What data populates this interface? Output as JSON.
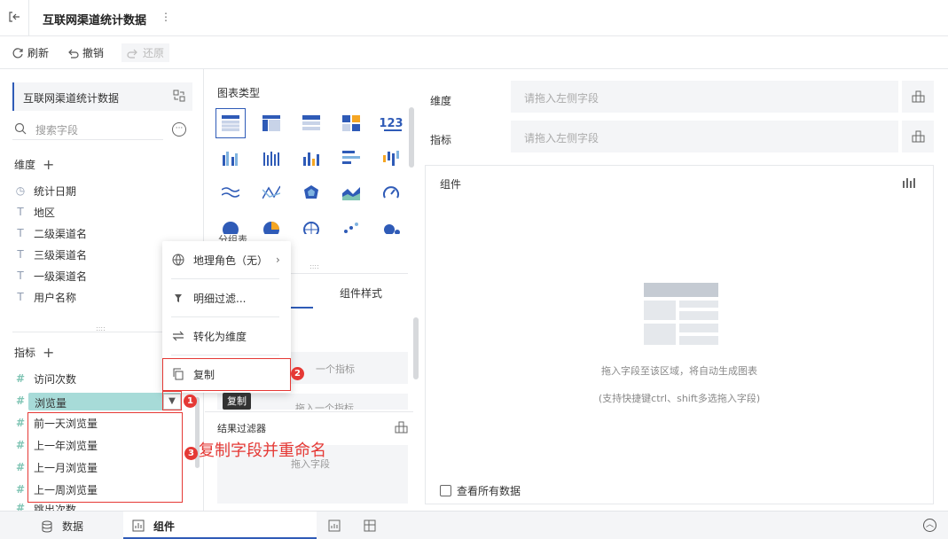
{
  "topbar": {
    "title": "互联网渠道统计数据",
    "more": "⋮"
  },
  "toolbar": {
    "refresh": "刷新",
    "undo": "撤销",
    "redo": "还原"
  },
  "left": {
    "dataset": "互联网渠道统计数据",
    "search_placeholder": "搜索字段",
    "dimension_header": "维度",
    "dimensions": [
      "统计日期",
      "地区",
      "二级渠道名",
      "三级渠道名",
      "一级渠道名",
      "用户名称"
    ],
    "metric_header": "指标",
    "metrics": [
      "访问次数",
      "浏览量",
      "前一天浏览量",
      "上一年浏览量",
      "上一月浏览量",
      "上一周浏览量",
      "跳出次数"
    ]
  },
  "middle": {
    "chart_type_label": "图表类型",
    "chart_icon_123": "123",
    "partial_label": "分组表",
    "tab_style": "组件样式",
    "placeholder_metric": "一个指标",
    "placeholder_drag_metric": "拖入一个指标",
    "result_filter": "结果过滤器",
    "drag_field": "拖入字段"
  },
  "right": {
    "dimension_label": "维度",
    "metric_label": "指标",
    "drop_placeholder": "请拖入左侧字段",
    "component_title": "组件",
    "empty_line1": "拖入字段至该区域，将自动生成图表",
    "empty_line2": "(支持快捷键ctrl、shift多选拖入字段)",
    "view_all": "查看所有数据"
  },
  "context_menu": {
    "geo": "地理角色（无）",
    "detail_filter": "明细过滤...",
    "to_dimension": "转化为维度",
    "copy": "复制"
  },
  "tooltip": "复制",
  "annotations": {
    "b1": "1",
    "b2": "2",
    "b3": "3",
    "note": "复制字段并重命名"
  },
  "bottom": {
    "data_tab": "数据",
    "component_tab": "组件"
  },
  "colors": {
    "accent": "#2f5bb7",
    "selected_field": "#a7dbd8",
    "annotation": "#e53935"
  }
}
